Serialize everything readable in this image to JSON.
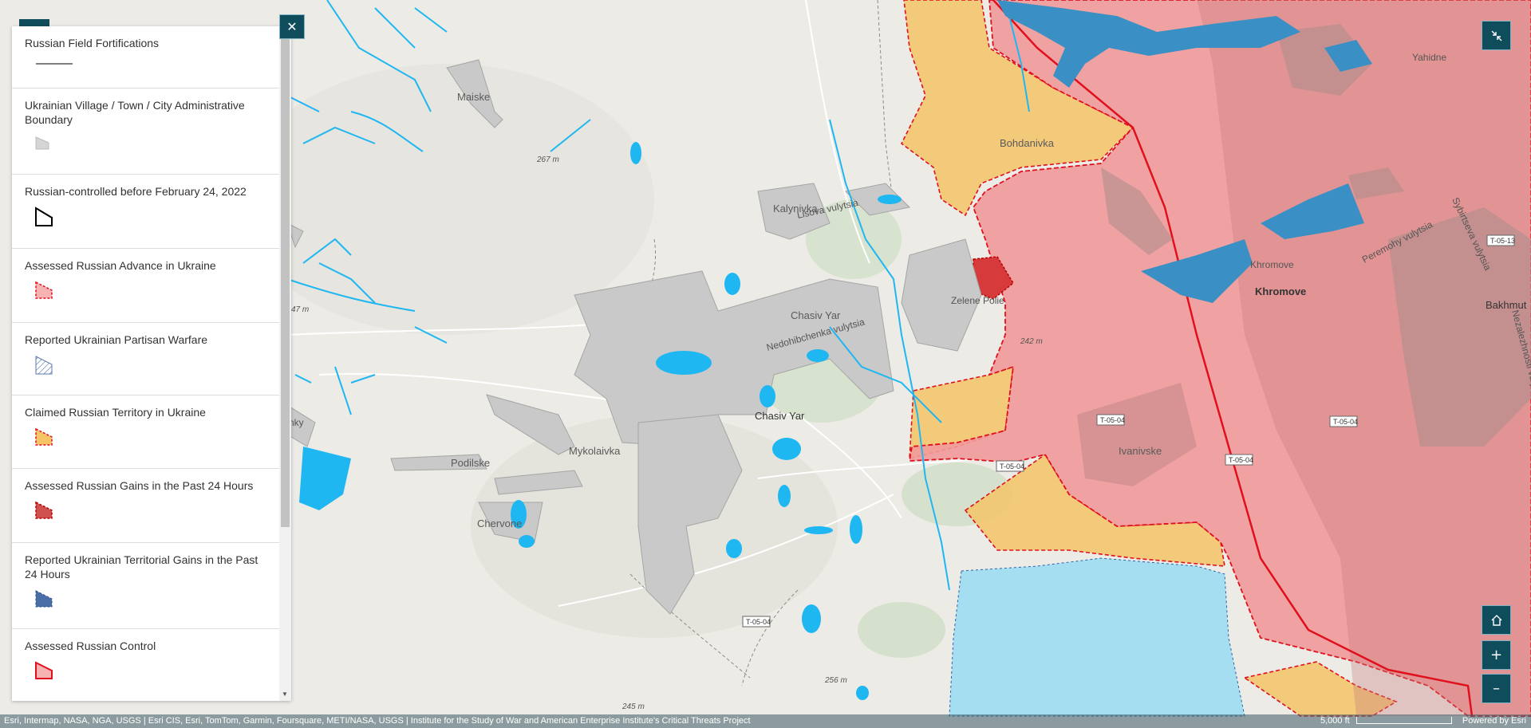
{
  "map": {
    "places": {
      "maiske": "Maiske",
      "bohdanivka": "Bohdanivka",
      "kalynivka": "Kalynivka",
      "kalynivka_street": "Lisova vulytsia",
      "chasiv_yar_district": "Chasiv Yar",
      "chasiv_yar": "Chasiv Yar",
      "nedohibchenka": "Nedohibchenka vulytsia",
      "zelene_pole": "Zelene Polie",
      "podilske": "Podilske",
      "mykolaivka": "Mykolaivka",
      "chervone": "Chervone",
      "ivanivske": "Ivanivske",
      "khromove_small": "Khromove",
      "khromove": "Khromove",
      "yahidne": "Yahidne",
      "bakhmut": "Bakhmut",
      "street_right1": "Peremohy vulytsia",
      "street_right2": "Sybirtseva vulytsia",
      "street_right3": "Nezalezhnosti vulytsia",
      "nky": "nky"
    },
    "elevations": {
      "e267": "267 m",
      "e47": "47 m",
      "e242": "242 m",
      "e256": "256 m",
      "e245": "245 m"
    },
    "roads": {
      "t0504a": "T-05-04",
      "t0504b": "T-05-04",
      "t0504c": "T-05-04",
      "t0504d": "T-05-04",
      "t0504e": "T-05-04",
      "t0513": "T-05-13"
    }
  },
  "legend": {
    "items": [
      {
        "label": "Russian Field Fortifications",
        "symbol": "line"
      },
      {
        "label": "Ukrainian Village / Town / City Administrative Boundary",
        "symbol": "gray-polygon"
      },
      {
        "label": "Russian-controlled before February 24, 2022",
        "symbol": "black-outline-polygon"
      },
      {
        "label": "Assessed Russian Advance in Ukraine",
        "symbol": "red-dashed-pink-polygon"
      },
      {
        "label": "Reported Ukrainian Partisan Warfare",
        "symbol": "blue-hatched-polygon"
      },
      {
        "label": "Claimed Russian Territory in Ukraine",
        "symbol": "orange-dashed-polygon"
      },
      {
        "label": "Assessed Russian Gains in the Past 24 Hours",
        "symbol": "dark-red-dashed-polygon"
      },
      {
        "label": "Reported Ukrainian Territorial Gains in the Past 24 Hours",
        "symbol": "blue-polygon"
      },
      {
        "label": "Assessed Russian Control",
        "symbol": "red-outline-pink-polygon"
      }
    ]
  },
  "controls": {
    "close_icon": "close-icon",
    "collapse_icon": "collapse-icon",
    "home_icon": "home-icon",
    "zoom_in_label": "+",
    "zoom_out_label": "–"
  },
  "attribution": {
    "text": "Esri, Intermap, NASA, NGA, USGS | Esri CIS, Esri, TomTom, Garmin, Foursquare, METI/NASA, USGS | Institute for the Study of War and American Enterprise Institute's Critical Threats Project",
    "scale": "5,000 ft",
    "powered_by": "Powered by Esri"
  },
  "colors": {
    "russian_control_fill": "#f19a9a",
    "russian_control_border": "#e0101d",
    "claimed_fill": "#f5c466",
    "ukrainian_gains_fill": "#a6def1",
    "water": "#1fb7f2",
    "town_fill": "#c9c9c9",
    "accent": "#0f4c5c"
  }
}
